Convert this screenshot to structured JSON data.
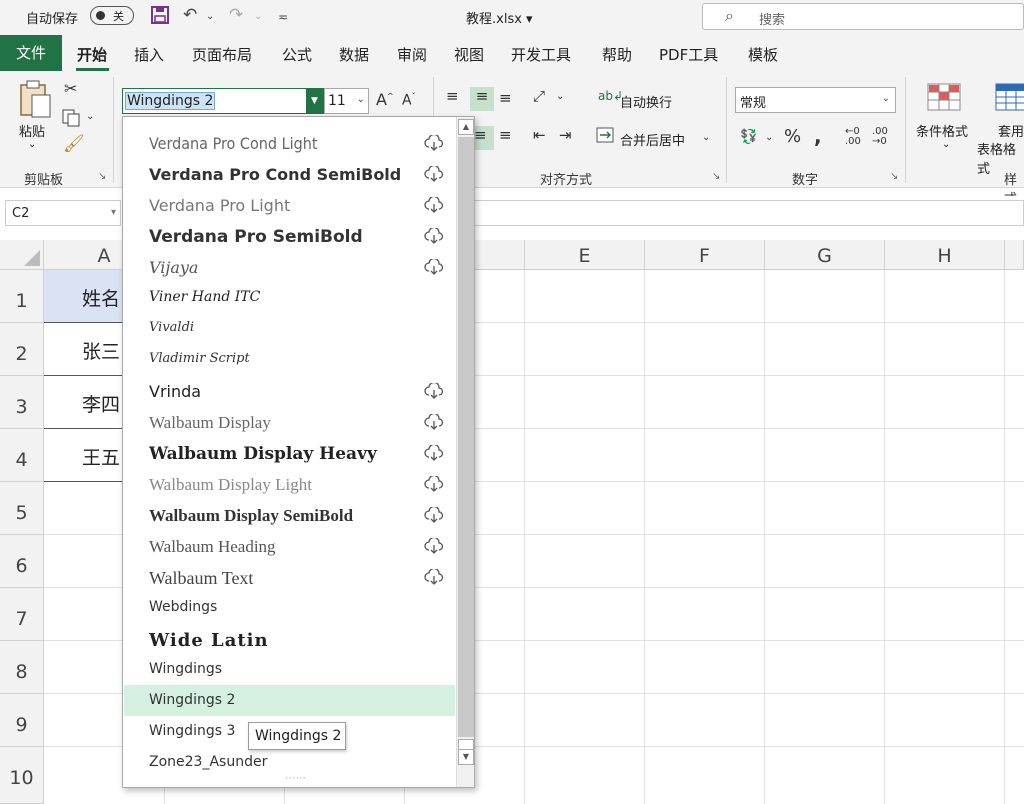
{
  "title_bar": {
    "autosave_label": "自动保存",
    "autosave_state": "关",
    "document_title": "教程.xlsx",
    "search_placeholder": "搜索"
  },
  "ribbon_tabs": [
    "文件",
    "开始",
    "插入",
    "页面布局",
    "公式",
    "数据",
    "审阅",
    "视图",
    "开发工具",
    "帮助",
    "PDF工具",
    "模板"
  ],
  "ribbon": {
    "paste_label": "粘贴",
    "clipboard_group": "剪贴板",
    "font_name": "Wingdings 2",
    "font_size": "11",
    "wrap_text": "自动换行",
    "merge_center": "合并后居中",
    "alignment_group": "对齐方式",
    "number_format": "常规",
    "number_group": "数字",
    "conditional_format": "条件格式",
    "table_format_line1": "套用",
    "table_format_line2": "表格格式",
    "styles_group": "样式"
  },
  "formula_bar": {
    "name_box": "C2"
  },
  "grid": {
    "column_headers": [
      "A",
      "E",
      "F",
      "G",
      "H"
    ],
    "row_headers": [
      "1",
      "2",
      "3",
      "4",
      "5",
      "6",
      "7",
      "8",
      "9",
      "10"
    ],
    "column_a_cells": [
      "姓名",
      "张三",
      "李四",
      "王五"
    ]
  },
  "font_dropdown": {
    "items": [
      {
        "name": "Verdana Pro Cond Light",
        "cloud": true
      },
      {
        "name": "Verdana Pro Cond SemiBold",
        "cloud": true
      },
      {
        "name": "Verdana Pro Light",
        "cloud": true
      },
      {
        "name": "Verdana Pro SemiBold",
        "cloud": true
      },
      {
        "name": "Vijaya",
        "cloud": true
      },
      {
        "name": "Viner Hand ITC",
        "cloud": false
      },
      {
        "name": "Vivaldi",
        "cloud": false
      },
      {
        "name": "Vladimir Script",
        "cloud": false
      },
      {
        "name": "Vrinda",
        "cloud": true
      },
      {
        "name": "Walbaum Display",
        "cloud": true
      },
      {
        "name": "Walbaum Display Heavy",
        "cloud": true
      },
      {
        "name": "Walbaum Display Light",
        "cloud": true
      },
      {
        "name": "Walbaum Display SemiBold",
        "cloud": true
      },
      {
        "name": "Walbaum Heading",
        "cloud": true
      },
      {
        "name": "Walbaum Text",
        "cloud": true
      },
      {
        "name": "Webdings",
        "cloud": false
      },
      {
        "name": "Wide Latin",
        "cloud": false
      },
      {
        "name": "Wingdings",
        "cloud": false
      },
      {
        "name": "Wingdings 2",
        "cloud": false,
        "selected": true
      },
      {
        "name": "Wingdings 3",
        "cloud": false
      },
      {
        "name": "Zone23_Asunder",
        "cloud": false
      }
    ],
    "tooltip": "Wingdings 2"
  },
  "colors": {
    "accent_green": "#217346",
    "selected_item_bg": "#d3f0e0",
    "header_cell_bg": "#dae3f3"
  }
}
